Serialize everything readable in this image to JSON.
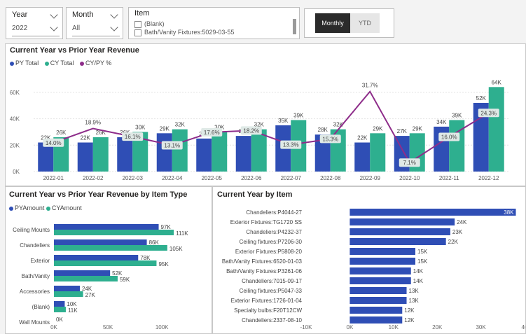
{
  "slicers": {
    "year": {
      "label": "Year",
      "value": "2022"
    },
    "month": {
      "label": "Month",
      "value": "All"
    },
    "item": {
      "label": "Item",
      "options": [
        "(Blank)",
        "Bath/Vanity Fixtures:5029-03-55"
      ]
    }
  },
  "toggle": {
    "monthly": "Monthly",
    "ytd": "YTD",
    "active": "Monthly"
  },
  "colors": {
    "py": "#2f4eb5",
    "cy": "#2eaf8f",
    "cypy": "#8e2d8a"
  },
  "chart_data": [
    {
      "type": "bar",
      "title": "Current Year vs Prior Year Revenue",
      "legend": [
        "PY Total",
        "CY Total",
        "CY/PY %"
      ],
      "categories": [
        "2022-01",
        "2022-02",
        "2022-03",
        "2022-04",
        "2022-05",
        "2022-06",
        "2022-07",
        "2022-08",
        "2022-09",
        "2022-10",
        "2022-11",
        "2022-12"
      ],
      "series": [
        {
          "name": "PY Total",
          "values": [
            22,
            22,
            26,
            29,
            25,
            27,
            35,
            28,
            22,
            27,
            34,
            52
          ],
          "labels": [
            "22K",
            "22K",
            "26K",
            "29K",
            "25K",
            "27K",
            "35K",
            "28K",
            "22K",
            "27K",
            "34K",
            "52K"
          ]
        },
        {
          "name": "CY Total",
          "values": [
            26,
            26,
            30,
            32,
            30,
            32,
            39,
            32,
            29,
            29,
            39,
            64
          ],
          "labels": [
            "26K",
            "26K",
            "30K",
            "32K",
            "30K",
            "32K",
            "39K",
            "32K",
            "29K",
            "29K",
            "39K",
            "64K"
          ]
        },
        {
          "name": "CY/PY %",
          "type": "line",
          "values": [
            14.0,
            18.9,
            16.1,
            13.1,
            17.6,
            18.2,
            13.3,
            15.3,
            31.7,
            7.1,
            16.0,
            24.3
          ],
          "labels": [
            "14.0%",
            "18.9%",
            "16.1%",
            "13.1%",
            "17.6%",
            "18.2%",
            "13.3%",
            "15.3%",
            "31.7%",
            "7.1%",
            "16.0%",
            "24.3%"
          ]
        }
      ],
      "yticks": [
        "0K",
        "20K",
        "40K",
        "60K"
      ],
      "ylim": [
        0,
        70
      ],
      "y2lim": [
        4,
        36
      ]
    },
    {
      "type": "bar",
      "orientation": "horizontal",
      "title": "Current Year vs Prior Year Revenue by Item Type",
      "legend": [
        "PYAmount",
        "CYAmount"
      ],
      "categories": [
        "Ceiling Mounts",
        "Chandeliers",
        "Exterior",
        "Bath/Vanity",
        "Accessories",
        "(Blank)",
        "Wall Mounts"
      ],
      "series": [
        {
          "name": "PYAmount",
          "values": [
            97,
            86,
            78,
            52,
            24,
            10,
            0
          ],
          "labels": [
            "97K",
            "86K",
            "78K",
            "52K",
            "24K",
            "10K",
            "0K"
          ]
        },
        {
          "name": "CYAmount",
          "values": [
            111,
            105,
            95,
            59,
            27,
            11,
            0
          ],
          "labels": [
            "111K",
            "105K",
            "95K",
            "59K",
            "27K",
            "11K",
            ""
          ]
        }
      ],
      "xticks": [
        "0K",
        "50K",
        "100K"
      ],
      "xlim": [
        0,
        120
      ]
    },
    {
      "type": "bar",
      "orientation": "horizontal",
      "title": "Current Year by Item",
      "categories": [
        "Chandeliers:P4044-27",
        "Exterior Fixtures:TG1720 SS",
        "Chandeliers:P4232-37",
        "Ceiling fixtures:P7206-30",
        "Exterior Fixtures:P5808-20",
        "Bath/Vanity Fixtures:6520-01-03",
        "Bath/Vanity Fixtures:P3261-06",
        "Chandeliers:7015-09-17",
        "Ceiling fixtures:P5047-33",
        "Exterior Fixtures:1726-01-04",
        "Specialty bulbs:F20T12CW",
        "Chandeliers:2337-08-10"
      ],
      "values": [
        38,
        24,
        23,
        22,
        15,
        15,
        14,
        14,
        13,
        13,
        12,
        12
      ],
      "labels": [
        "38K",
        "24K",
        "23K",
        "22K",
        "15K",
        "15K",
        "14K",
        "14K",
        "13K",
        "13K",
        "12K",
        "12K"
      ],
      "xticks": [
        "-10K",
        "0K",
        "10K",
        "20K",
        "30K",
        "40"
      ],
      "xlim": [
        -10,
        40
      ]
    }
  ]
}
